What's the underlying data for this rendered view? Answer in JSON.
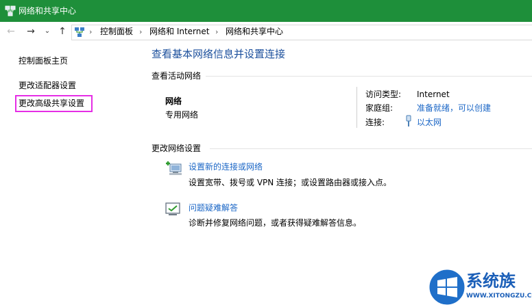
{
  "window": {
    "title": "网络和共享中心"
  },
  "nav": {
    "back_icon": "←",
    "forward_icon": "→",
    "recent_icon": "⌄",
    "up_icon": "↑",
    "breadcrumbs": [
      "控制面板",
      "网络和 Internet",
      "网络和共享中心"
    ],
    "separator": "›"
  },
  "sidebar": {
    "items": [
      {
        "label": "控制面板主页"
      },
      {
        "label": "更改适配器设置"
      },
      {
        "label": "更改高级共享设置"
      }
    ],
    "highlight_color": "#e52de5"
  },
  "main": {
    "title": "查看基本网络信息并设置连接",
    "active_section": "查看活动网络",
    "network": {
      "name": "网络",
      "type": "专用网络"
    },
    "details": {
      "access_label": "访问类型:",
      "access_value": "Internet",
      "homegroup_label": "家庭组:",
      "homegroup_value": "准备就绪，可以创建",
      "connection_label": "连接:",
      "connection_value": "以太网"
    },
    "change_section": "更改网络设置",
    "actions": [
      {
        "title": "设置新的连接或网络",
        "desc": "设置宽带、拨号或 VPN 连接；或设置路由器或接入点。",
        "icon": "new-connection-icon"
      },
      {
        "title": "问题疑难解答",
        "desc": "诊断并修复网络问题，或者获得疑难解答信息。",
        "icon": "troubleshoot-icon"
      }
    ]
  },
  "watermark": {
    "brand": "系统族",
    "url": "WWW.XITONGZU.COM"
  },
  "colors": {
    "titlebar": "#1e8f3a",
    "link": "#1a66c6",
    "heading": "#1b4f9c"
  }
}
